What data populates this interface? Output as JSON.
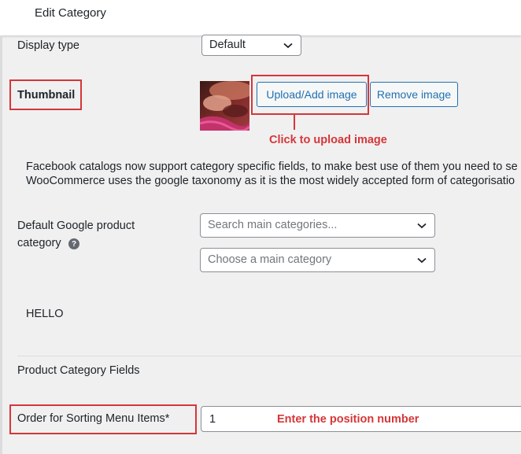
{
  "header": {
    "title": "Edit Category"
  },
  "display_type": {
    "label": "Display type",
    "value": "Default"
  },
  "thumbnail": {
    "label": "Thumbnail",
    "upload_button": "Upload/Add image",
    "remove_button": "Remove image",
    "annotation": "Click to upload image"
  },
  "facebook_notice": {
    "line1": "Facebook catalogs now support category specific fields, to make best use of them you need to se",
    "line2": "WooCommerce uses the google taxonomy as it is the most widely accepted form of categorisatio"
  },
  "google_category": {
    "label_line1": "Default Google product",
    "label_line2": "category",
    "search_placeholder": "Search main categories...",
    "choose_placeholder": "Choose a main category"
  },
  "hello_text": "HELLO",
  "section_title": "Product Category Fields",
  "order_field": {
    "label": "Order for Sorting Menu Items*",
    "value": "1",
    "annotation": "Enter the position number"
  },
  "colors": {
    "accent": "#2271b1",
    "annotation_red": "#d63638"
  }
}
